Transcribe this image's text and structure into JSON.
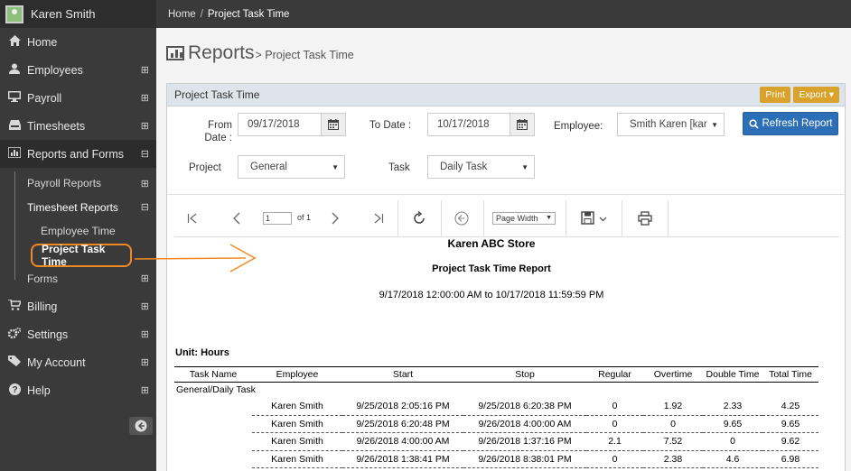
{
  "user": {
    "name": "Karen Smith"
  },
  "breadcrumb": {
    "home": "Home",
    "separator": "/",
    "current": "Project Task Time"
  },
  "sidebar": {
    "items": [
      {
        "label": "Home",
        "icon": "home-icon",
        "expand": ""
      },
      {
        "label": "Employees",
        "icon": "user-icon",
        "expand": "⊞"
      },
      {
        "label": "Payroll",
        "icon": "monitor-icon",
        "expand": "⊞"
      },
      {
        "label": "Timesheets",
        "icon": "inbox-icon",
        "expand": "⊞"
      },
      {
        "label": "Reports and Forms",
        "icon": "bar-chart-icon",
        "expand": "⊟"
      }
    ],
    "reports_sub": {
      "payroll_reports": "Payroll Reports",
      "timesheet_reports": "Timesheet Reports",
      "employee_time": "Employee Time",
      "project_task_time": "Project Task Time",
      "forms": "Forms"
    },
    "bottom_items": [
      {
        "label": "Billing",
        "icon": "cart-icon",
        "expand": "⊞"
      },
      {
        "label": "Settings",
        "icon": "gears-icon",
        "expand": "⊞"
      },
      {
        "label": "My Account",
        "icon": "tag-icon",
        "expand": "⊞"
      },
      {
        "label": "Help",
        "icon": "help-icon",
        "expand": "⊞"
      }
    ],
    "expand_plus": "⊞",
    "expand_minus": "⊟"
  },
  "page": {
    "title": "Reports",
    "subtitle": "> Project Task Time"
  },
  "panel": {
    "title": "Project Task Time",
    "print_label": "Print",
    "export_label": "Export ▾"
  },
  "filters": {
    "from_label": "From Date :",
    "from_value": "09/17/2018",
    "to_label": "To Date :",
    "to_value": "10/17/2018",
    "employee_label": "Employee:",
    "employee_value": "Smith Karen [kar",
    "project_label": "Project",
    "project_value": "General",
    "task_label": "Task",
    "task_value": "Daily Task",
    "refresh_label": "Refresh Report"
  },
  "viewer": {
    "page_number": "1",
    "page_of": "of 1",
    "zoom": "Page Width"
  },
  "report": {
    "store": "Karen ABC Store",
    "title": "Project Task Time Report",
    "range": "9/17/2018 12:00:00 AM to 10/17/2018 11:59:59 PM",
    "unit": "Unit: Hours",
    "columns": [
      "Task Name",
      "Employee",
      "Start",
      "Stop",
      "Regular",
      "Overtime",
      "Double Time",
      "Total Time"
    ],
    "group": "General/Daily Task",
    "rows": [
      [
        "Karen Smith",
        "9/25/2018 2:05:16 PM",
        "9/25/2018 6:20:38 PM",
        "0",
        "1.92",
        "2.33",
        "4.25"
      ],
      [
        "Karen Smith",
        "9/25/2018 6:20:48 PM",
        "9/26/2018 4:00:00 AM",
        "0",
        "0",
        "9.65",
        "9.65"
      ],
      [
        "Karen Smith",
        "9/26/2018 4:00:00 AM",
        "9/26/2018 1:37:16 PM",
        "2.1",
        "7.52",
        "0",
        "9.62"
      ],
      [
        "Karen Smith",
        "9/26/2018 1:38:41 PM",
        "9/26/2018 8:38:01 PM",
        "0",
        "2.38",
        "4.6",
        "6.98"
      ]
    ]
  },
  "colors": {
    "sidebar_bg": "#3a3a3a",
    "accent_orange": "#f08a24",
    "button_blue": "#2c6fb6",
    "button_gold": "#d9a22a"
  }
}
